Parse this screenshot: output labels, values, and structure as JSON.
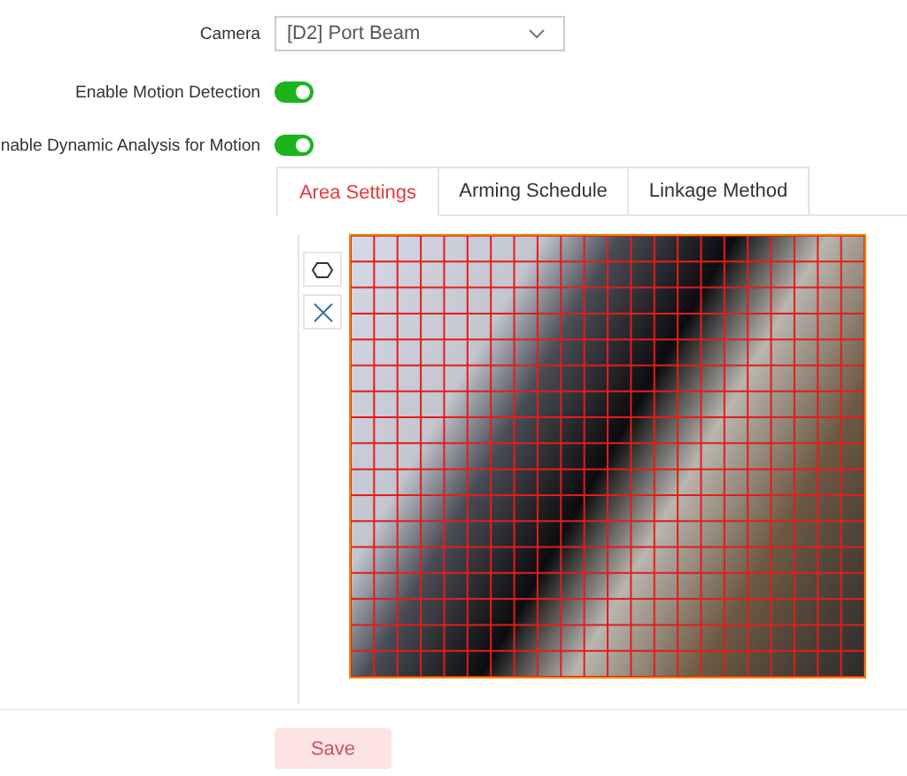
{
  "camera": {
    "label": "Camera",
    "value": "[D2] Port Beam"
  },
  "toggles": [
    {
      "label": "Enable Motion Detection",
      "on": true
    },
    {
      "label": "nable Dynamic Analysis for Motion",
      "on": true
    }
  ],
  "tabs": [
    {
      "label": "Area Settings",
      "selected": true
    },
    {
      "label": "Arming Schedule",
      "selected": false
    },
    {
      "label": "Linkage Method",
      "selected": false
    }
  ],
  "tools": [
    {
      "kind": "polygon"
    },
    {
      "kind": "clear"
    }
  ],
  "save_button": {
    "label": "Save",
    "disabled": true
  }
}
